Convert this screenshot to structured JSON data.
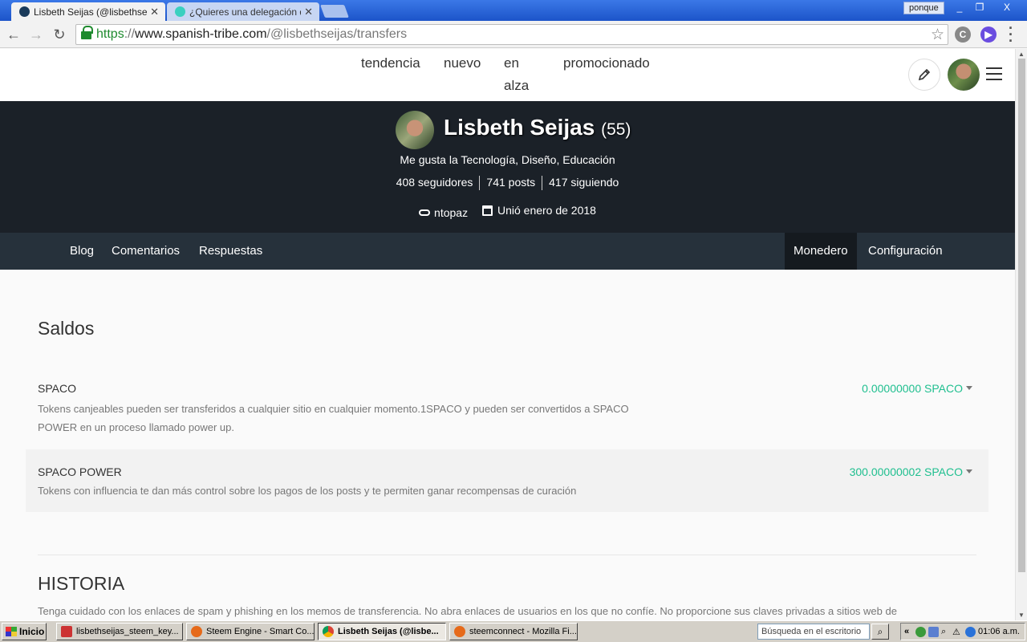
{
  "browser": {
    "tabs": [
      {
        "title": "Lisbeth Seijas (@lisbethseijas",
        "favicon_color": "#1a3a5a"
      },
      {
        "title": "¿Quieres una delegación de S",
        "favicon_color": "#3ad0c0"
      }
    ],
    "user_button": "ponque",
    "window_buttons": [
      "_",
      "❐",
      "X"
    ],
    "url": {
      "scheme": "https",
      "sep": "://",
      "host": "www.spanish-tribe.com",
      "path": "/@lisbethseijas/transfers"
    }
  },
  "site": {
    "nav": [
      "tendencia",
      "nuevo",
      "en",
      "alza",
      "promocionado"
    ],
    "profile": {
      "name": "Lisbeth Seijas",
      "reputation": "(55)",
      "about": "Me gusta la Tecnología, Diseño, Educación",
      "followers": "408 seguidores",
      "posts": "741 posts",
      "following": "417 siguiendo",
      "website": "ntopaz",
      "joined": "Unió enero de 2018"
    },
    "subnav": {
      "left": [
        "Blog",
        "Comentarios",
        "Respuestas"
      ],
      "wallet": "Monedero",
      "settings": "Configuración"
    },
    "wallet": {
      "title": "Saldos",
      "balances": [
        {
          "name": "SPACO",
          "desc1": "Tokens canjeables pueden ser transferidos a cualquier sitio en cualquier momento.1SPACO y pueden ser convertidos a SPACO",
          "desc2": "POWER en un proceso llamado power up.",
          "value": "0.00000000 SPACO"
        },
        {
          "name": "SPACO POWER",
          "desc1": "Tokens con influencia te dan más control sobre los pagos de los posts y te permiten ganar recompensas de curación",
          "desc2": "",
          "value": "300.00000002 SPACO"
        }
      ],
      "history_title": "HISTORIA",
      "history_note": "Tenga cuidado con los enlaces de spam y phishing en los memos de transferencia. No abra enlaces de usuarios en los que no confíe. No proporcione sus claves privadas a sitios web de"
    },
    "accent_color": "#1fbf8f"
  },
  "taskbar": {
    "start": "Inicio",
    "tasks": [
      {
        "label": "lisbethseijas_steem_key...",
        "icon_color": "#c33"
      },
      {
        "label": "Steem Engine - Smart Co...",
        "icon_color": "#e66a1a"
      },
      {
        "label": "Lisbeth Seijas (@lisbe...",
        "icon_color": "#3a8be0"
      },
      {
        "label": "steemconnect - Mozilla Fi...",
        "icon_color": "#e66a1a"
      }
    ],
    "search_placeholder": "Búsqueda en el escritorio",
    "clock": "01:06 a.m."
  }
}
